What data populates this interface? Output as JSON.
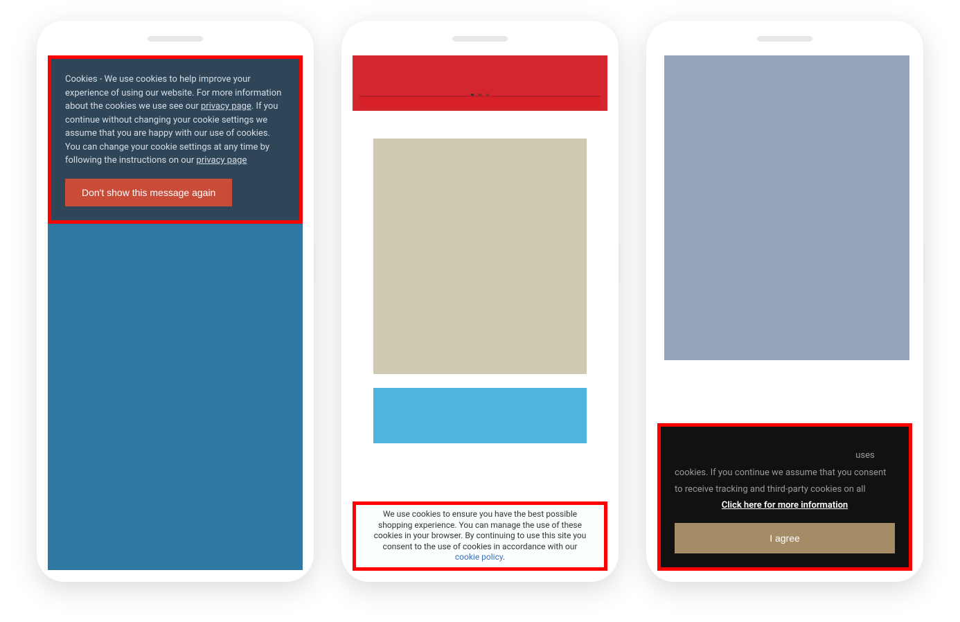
{
  "phone1": {
    "cookie_banner": {
      "text_1": "Cookies - We use cookies to help improve your experience of using our website. For more information about the cookies we use see our ",
      "link_1": "privacy page",
      "text_2": ". If you continue without changing your cookie settings we assume that you are happy with our use of cookies. You can change your cookie settings at any time by following the instructions on our ",
      "link_2": "privacy page",
      "button_label": "Don't show this message again"
    }
  },
  "phone2": {
    "cookie_banner": {
      "text": "We use cookies to ensure you have the best possible shopping experience. You can manage the use of these cookies in your browser. By continuing to use this site you consent to the use of cookies in accordance with our ",
      "link": "cookie policy",
      "suffix": "."
    }
  },
  "phone3": {
    "cookie_banner": {
      "text": "uses cookies. If you continue we assume that you consent to receive tracking and third-party cookies on all",
      "link": "Click here for more information",
      "button_label": "I agree"
    }
  }
}
